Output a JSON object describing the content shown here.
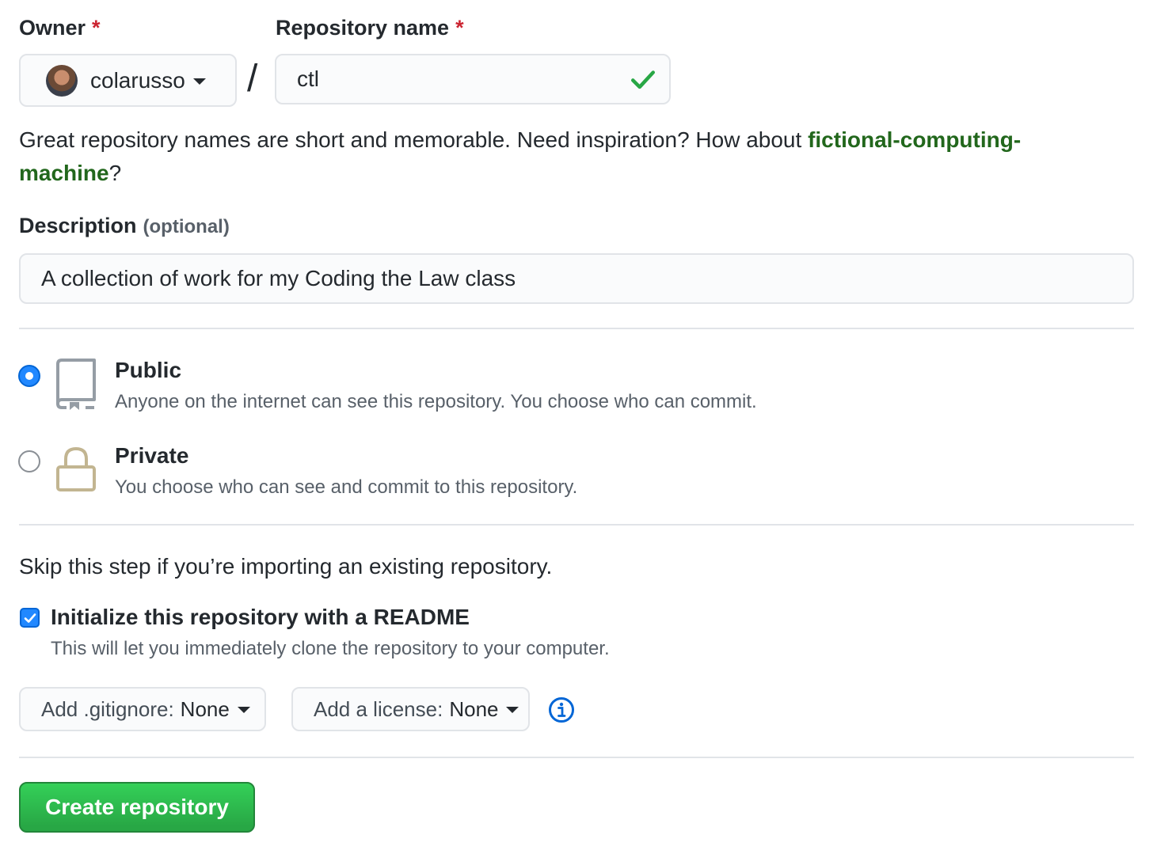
{
  "owner": {
    "label": "Owner",
    "required_mark": "*",
    "selected": "colarusso"
  },
  "separator": "/",
  "repository_name": {
    "label": "Repository name",
    "required_mark": "*",
    "value": "ctl",
    "valid_icon": "check-icon"
  },
  "hint": {
    "prefix": "Great repository names are short and memorable. Need inspiration? How about ",
    "suggestion": "fictional-computing-machine",
    "suffix": "?"
  },
  "description": {
    "label": "Description",
    "optional": "(optional)",
    "value": "A collection of work for my Coding the Law class"
  },
  "visibility": {
    "public": {
      "title": "Public",
      "desc": "Anyone on the internet can see this repository. You choose who can commit.",
      "selected": true,
      "icon": "repo-icon"
    },
    "private": {
      "title": "Private",
      "desc": "You choose who can see and commit to this repository.",
      "selected": false,
      "icon": "lock-icon"
    }
  },
  "init": {
    "skip_text": "Skip this step if you’re importing an existing repository.",
    "readme_label": "Initialize this repository with a README",
    "readme_desc": "This will let you immediately clone the repository to your computer.",
    "readme_checked": true
  },
  "gitignore": {
    "label": "Add .gitignore:",
    "value": "None"
  },
  "license": {
    "label": "Add a license:",
    "value": "None"
  },
  "submit_label": "Create repository",
  "colors": {
    "accent_blue": "#0366d6",
    "success_green": "#28a745",
    "suggestion_green": "#22671c",
    "required_red": "#cb2431"
  }
}
